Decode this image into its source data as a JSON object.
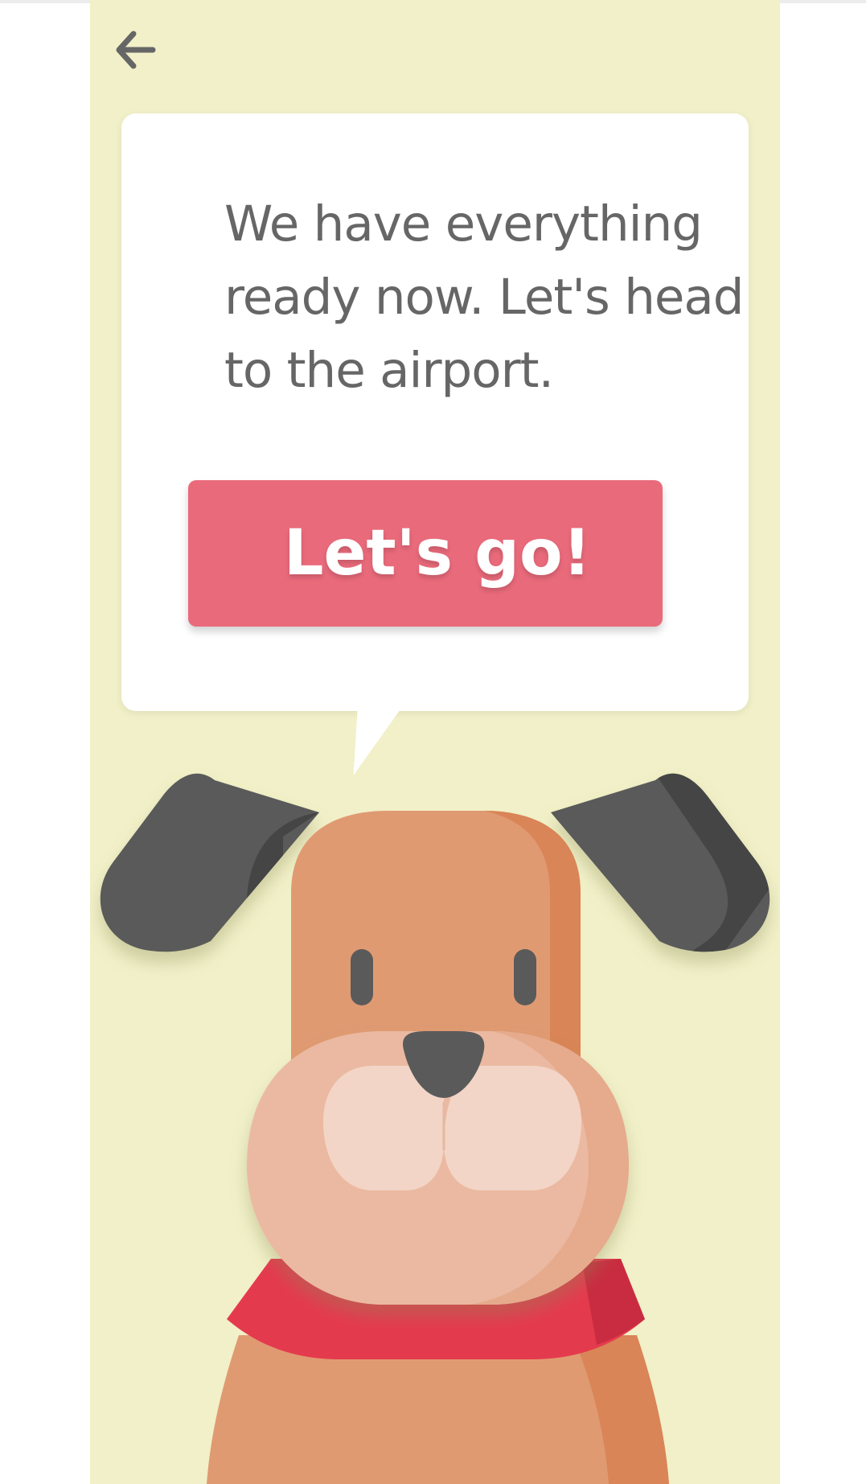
{
  "screen": {
    "message": "We have everything ready now. Let's head to the airport.",
    "primary_button_label": "Let's go!"
  },
  "icons": {
    "back": "arrow-left-icon",
    "mascot": "dog-icon"
  },
  "colors": {
    "background": "#f1f0c8",
    "bubble": "#ffffff",
    "button": "#e96a7b",
    "text": "#666666",
    "button_text": "#ffffff"
  }
}
